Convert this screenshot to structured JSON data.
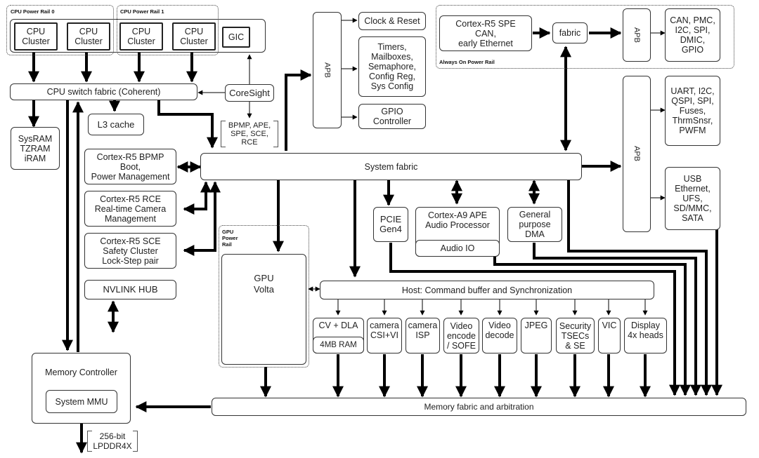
{
  "rails": {
    "cpu0": "CPU Power Rail 0",
    "cpu1": "CPU Power Rail 1",
    "always_on": "Always On Power Rail",
    "gpu": "GPU\nPower\nRail"
  },
  "cpu": {
    "clusters": [
      "CPU\nCluster",
      "CPU\nCluster",
      "CPU\nCluster",
      "CPU\nCluster"
    ],
    "gic": "GIC",
    "switch_fabric": "CPU switch fabric (Coherent)",
    "coresight": "CoreSight",
    "coresight_targets": "BPMP, APE,\nSPE, SCE,\nRCE",
    "sysram": "SysRAM\nTZRAM\niRAM",
    "l3": "L3 cache"
  },
  "apb_left": {
    "label": "APB",
    "clock_reset": "Clock & Reset",
    "timers": "Timers,\nMailboxes,\nSemaphore,\nConfig Reg,\nSys Config",
    "gpio": "GPIO\nController"
  },
  "always_on": {
    "spe": "Cortex-R5 SPE\nCAN,\nearly Ethernet",
    "fabric": "fabric",
    "apb": "APB",
    "peripherals": "CAN, PMC,\nI2C, SPI,\nDMIC,\nGPIO"
  },
  "apb_right": {
    "label": "APB",
    "uart": "UART, I2C,\nQSPI, SPI,\nFuses,\nThrmSnsr,\nPWFM",
    "usb": "USB\nEthernet,\nUFS,\nSD/MMC,\nSATA"
  },
  "system_fabric": "System fabric",
  "r5": {
    "bpmp": "Cortex-R5 BPMP\nBoot,\nPower Management",
    "rce": "Cortex-R5 RCE\nReal-time Camera\nManagement",
    "sce": "Cortex-R5 SCE\nSafety Cluster\nLock-Step pair"
  },
  "nvlink": "NVLINK HUB",
  "gpu": "GPU\nVolta",
  "pcie": "PCIE\nGen4",
  "ape": "Cortex-A9 APE\nAudio Processor",
  "audio_io": "Audio IO",
  "dma": "General\npurpose\nDMA",
  "host": "Host: Command buffer and Synchronization",
  "engines": {
    "cv": "CV + DLA",
    "cv_ram": "4MB RAM",
    "csi": "camera\nCSI+VI",
    "isp": "camera\nISP",
    "venc": "Video\nencode\n/ SOFE",
    "vdec": "Video\ndecode",
    "jpeg": "JPEG",
    "security": "Security\nTSECs\n& SE",
    "vic": "VIC",
    "display": "Display\n4x heads"
  },
  "memory": {
    "controller": "Memory Controller",
    "mmu": "System MMU",
    "fabric": "Memory fabric and arbitration",
    "dram": "256-bit\nLPDDR4X"
  }
}
